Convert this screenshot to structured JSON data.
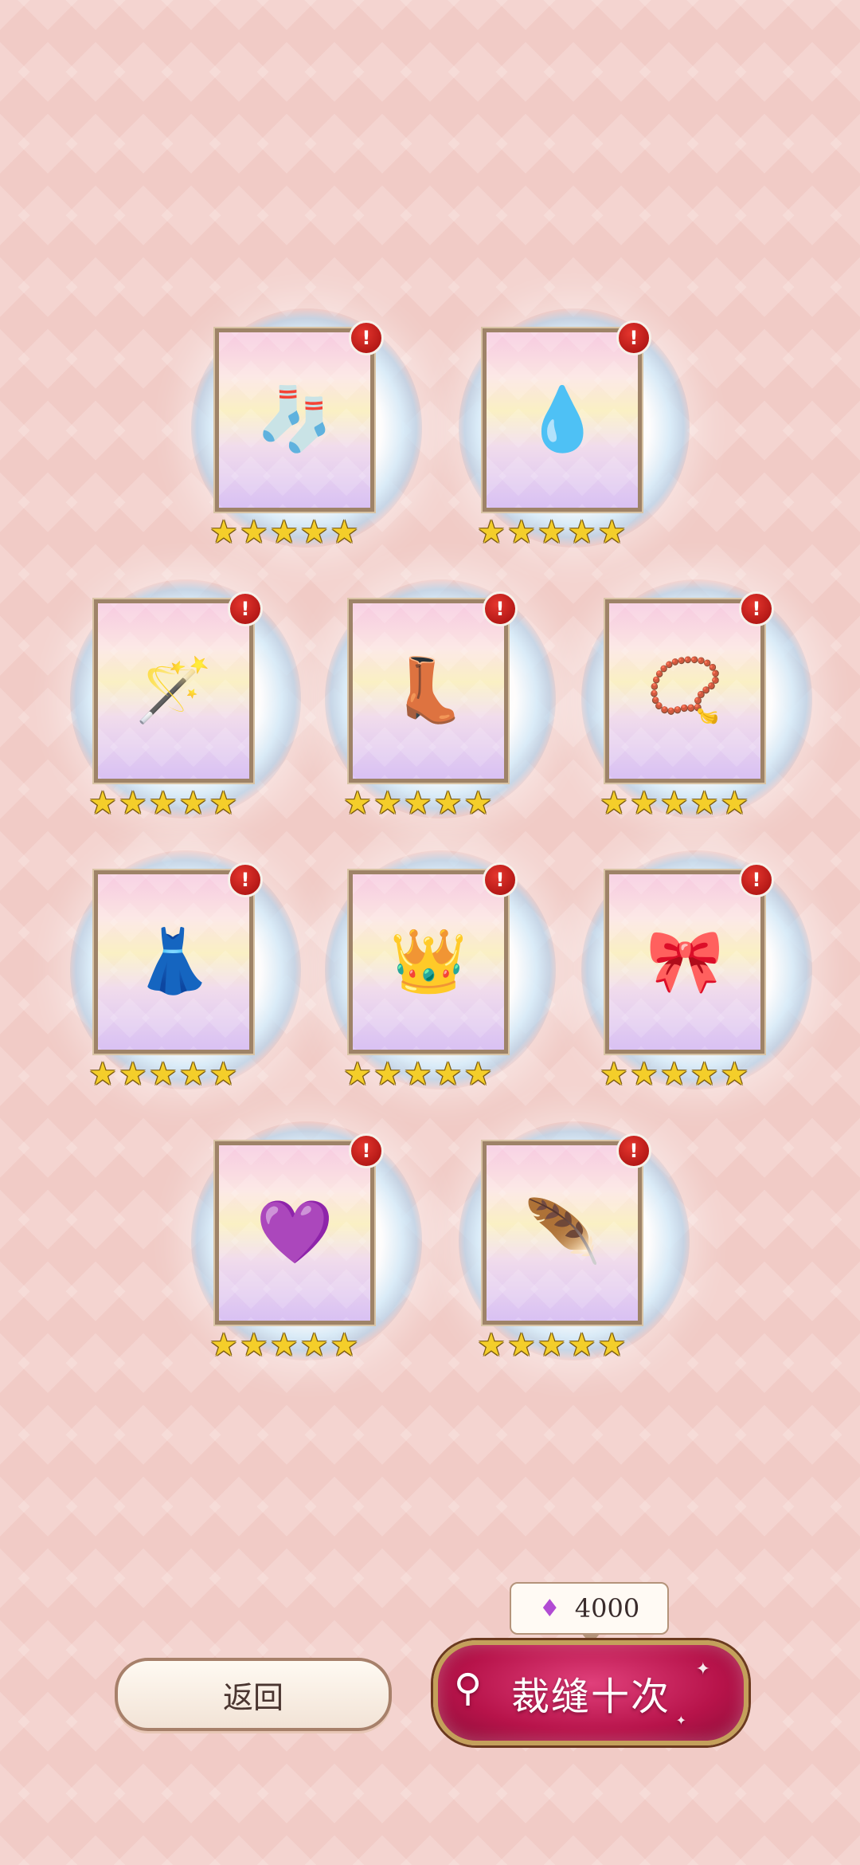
{
  "items": [
    {
      "icon": "stockings-icon",
      "glyph": "🧦",
      "badge": "!",
      "stars": [
        "★",
        "★",
        "★",
        "★",
        "★"
      ]
    },
    {
      "icon": "blue-drop-gem-icon",
      "glyph": "💧",
      "badge": "!",
      "stars": [
        "★",
        "★",
        "★",
        "★",
        "★"
      ]
    },
    {
      "icon": "magic-wand-icon",
      "glyph": "🪄",
      "badge": "!",
      "stars": [
        "★",
        "★",
        "★",
        "★",
        "★"
      ]
    },
    {
      "icon": "lace-boots-icon",
      "glyph": "👢",
      "badge": "!",
      "stars": [
        "★",
        "★",
        "★",
        "★",
        "★"
      ]
    },
    {
      "icon": "jeweled-bracelet-icon",
      "glyph": "📿",
      "badge": "!",
      "stars": [
        "★",
        "★",
        "★",
        "★",
        "★"
      ]
    },
    {
      "icon": "lace-skirt-icon",
      "glyph": "👗",
      "badge": "!",
      "stars": [
        "★",
        "★",
        "★",
        "★",
        "★"
      ]
    },
    {
      "icon": "feather-headpiece-icon",
      "glyph": "👑",
      "badge": "!",
      "stars": [
        "★",
        "★",
        "★",
        "★",
        "★"
      ]
    },
    {
      "icon": "capelet-icon",
      "glyph": "🎀",
      "badge": "!",
      "stars": [
        "★",
        "★",
        "★",
        "★",
        "★"
      ]
    },
    {
      "icon": "purple-drop-gem-icon",
      "glyph": "💜",
      "badge": "!",
      "stars": [
        "★",
        "★",
        "★",
        "★",
        "★"
      ]
    },
    {
      "icon": "feather-effect-icon",
      "glyph": "🪶",
      "badge": "!",
      "stars": [
        "★",
        "★",
        "★",
        "★",
        "★"
      ]
    }
  ],
  "footer": {
    "back_label": "返回",
    "cost_icon": "diamond-icon",
    "cost_value": "4000",
    "sew_label": "裁缝十次"
  },
  "colors": {
    "background": "#f1cbc6",
    "badge": "#c8201d",
    "star": "#f4ce2a",
    "sew_button": "#c21a55"
  }
}
